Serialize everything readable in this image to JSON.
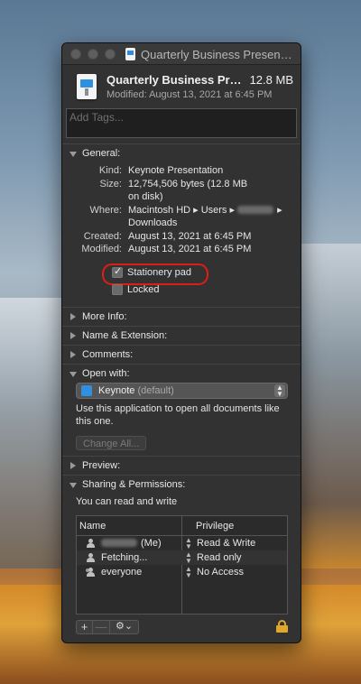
{
  "window": {
    "title": "Quarterly Business Presen…"
  },
  "header": {
    "name": "Quarterly Business Pr…",
    "size": "12.8 MB",
    "modified": "Modified: August 13, 2021 at 6:45 PM"
  },
  "tags": {
    "placeholder": "Add Tags..."
  },
  "general": {
    "title": "General:",
    "kind_label": "Kind:",
    "kind": "Keynote Presentation",
    "size_label": "Size:",
    "size_line1": "12,754,506 bytes (12.8 MB",
    "size_line2": "on disk)",
    "where_label": "Where:",
    "where_line1": "Macintosh HD ▸ Users ▸",
    "where_sep": "▸",
    "where_line2": "Downloads",
    "created_label": "Created:",
    "created": "August 13, 2021 at 6:45 PM",
    "modified_label": "Modified:",
    "modified": "August 13, 2021 at 6:45 PM",
    "stationery_label": "Stationery pad",
    "stationery_checked": true,
    "locked_label": "Locked",
    "locked_checked": false,
    "highlight_color": "#e01c17"
  },
  "sections": {
    "more_info": "More Info:",
    "name_ext": "Name & Extension:",
    "comments": "Comments:",
    "open_with": "Open with:",
    "preview": "Preview:",
    "sharing": "Sharing & Permissions:"
  },
  "open_with": {
    "app": "Keynote",
    "default_suffix": "(default)",
    "description": "Use this application to open all documents like this one.",
    "change_all": "Change All..."
  },
  "permissions": {
    "description": "You can read and write",
    "col_name": "Name",
    "col_privilege": "Privilege",
    "rows": [
      {
        "name_suffix": "(Me)",
        "privilege": "Read & Write",
        "icon": "person-icon"
      },
      {
        "name": "Fetching...",
        "privilege": "Read only",
        "icon": "person-icon"
      },
      {
        "name": "everyone",
        "privilege": "No Access",
        "icon": "group-icon"
      }
    ]
  },
  "toolbar": {
    "add": "+",
    "remove": "—",
    "gear": "⚙︎⌄",
    "lock_color": "#e0a72a"
  }
}
